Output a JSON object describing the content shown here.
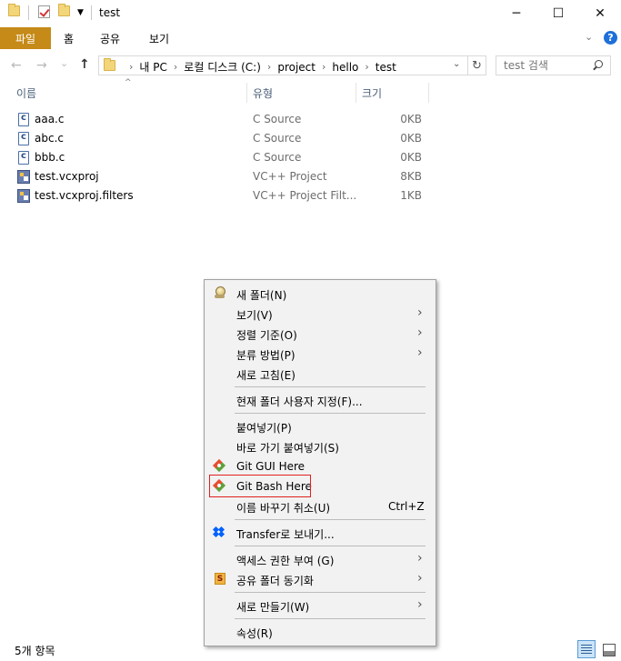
{
  "window": {
    "title": "test",
    "minimize": "─",
    "maximize": "☐",
    "close": "✕"
  },
  "ribbon": {
    "tabs": [
      "파일",
      "홈",
      "공유",
      "보기"
    ],
    "collapse_chevron": "⌄",
    "help": "?"
  },
  "nav": {
    "back": "←",
    "forward": "→",
    "recent": "⌄",
    "up": "↑",
    "breadcrumb": [
      "내 PC",
      "로컬 디스크 (C:)",
      "project",
      "hello",
      "test"
    ],
    "crumb_separator": "›",
    "dropdown": "⌄",
    "refresh": "↻",
    "search_placeholder": "test 검색"
  },
  "columns": {
    "name": "이름",
    "type": "유형",
    "size": "크기",
    "sort_indicator": "^"
  },
  "files": [
    {
      "name": "aaa.c",
      "type": "C Source",
      "size": "0KB",
      "icon": "c-source-file-icon"
    },
    {
      "name": "abc.c",
      "type": "C Source",
      "size": "0KB",
      "icon": "c-source-file-icon"
    },
    {
      "name": "bbb.c",
      "type": "C Source",
      "size": "0KB",
      "icon": "c-source-file-icon"
    },
    {
      "name": "test.vcxproj",
      "type": "VC++ Project",
      "size": "8KB",
      "icon": "vc-project-file-icon"
    },
    {
      "name": "test.vcxproj.filters",
      "type": "VC++ Project Filt...",
      "size": "1KB",
      "icon": "vc-project-file-icon"
    }
  ],
  "context_menu": {
    "items": {
      "new_folder": "새 폴더(N)",
      "view": "보기(V)",
      "sort_by": "정렬 기준(O)",
      "group_by": "분류 방법(P)",
      "refresh": "새로 고침(E)",
      "customize_folder": "현재 폴더 사용자 지정(F)...",
      "paste": "붙여넣기(P)",
      "paste_shortcut": "바로 가기 붙여넣기(S)",
      "git_gui": "Git GUI Here",
      "git_bash": "Git Bash Here",
      "undo_rename": "이름 바꾸기 취소(U)",
      "undo_rename_shortcut": "Ctrl+Z",
      "transfer": "Transfer로 보내기...",
      "give_access": "액세스 권한 부여 (G)",
      "sync_shared": "공유 폴더 동기화",
      "sync_badge": "S",
      "new": "새로 만들기(W)",
      "properties": "속성(R)"
    },
    "submenu_arrow": "›",
    "highlight_color": "#e02020"
  },
  "statusbar": {
    "item_count": "5개 항목"
  },
  "colors": {
    "file_tab": "#c58a17",
    "accent": "#1e6fd9",
    "folder": "#f3d67a"
  }
}
